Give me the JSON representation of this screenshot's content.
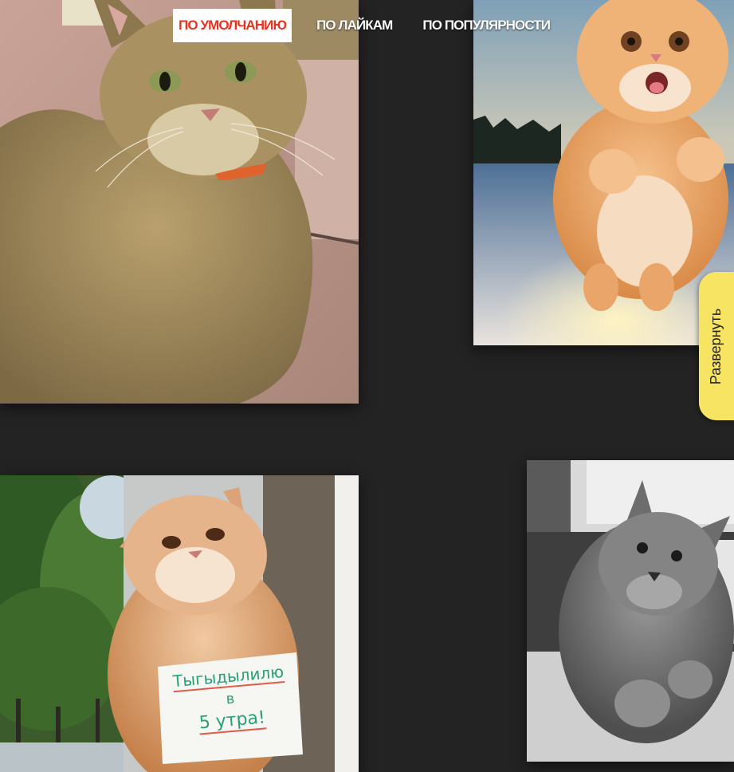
{
  "sort": {
    "options": [
      {
        "label": "ПО УМОЛЧАНИЮ",
        "active": true
      },
      {
        "label": "ПО ЛАЙКАМ",
        "active": false
      },
      {
        "label": "ПО ПОПУЛЯРНОСТИ",
        "active": false
      }
    ]
  },
  "expand_tab": {
    "label": "Развернуть"
  },
  "photos": [
    {
      "subject": "tabby-cat"
    },
    {
      "subject": "ginger-cat-jumping-in-snow"
    },
    {
      "subject": "ginger-cat-with-note"
    },
    {
      "subject": "grey-cat-on-sofa"
    }
  ],
  "note": {
    "line1": "Тыгыдылилю",
    "line2": "в",
    "line3": "5 утра!"
  },
  "colors": {
    "background": "#232323",
    "active_sort_text": "#e8321f",
    "active_sort_bg": "#ffffff",
    "expand_tab_bg": "#f7e463"
  }
}
